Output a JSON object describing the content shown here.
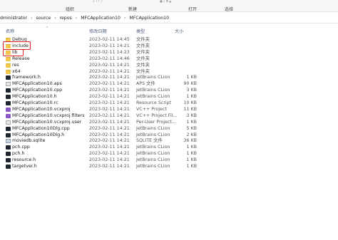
{
  "ribbon": {
    "top_tiny_left": "2 7 T 7",
    "top_tiny_right": "■ 2 ▼ ▲",
    "groups": [
      "组织",
      "新建",
      "打开",
      "选择"
    ]
  },
  "address": {
    "breadcrumbs": [
      "dministrator",
      "source",
      "repos",
      "MFCApplication10",
      "MFCApplication10"
    ]
  },
  "columns": {
    "name": "名称",
    "date": "修改日期",
    "type": "类型",
    "size": "大小"
  },
  "files": [
    {
      "name": "Debug",
      "date": "2023-02-11 14:45",
      "type": "文件夹",
      "size": "",
      "icon": "folder-icon"
    },
    {
      "name": "include",
      "date": "2023-02-11 14:21",
      "type": "文件夹",
      "size": "",
      "icon": "folder-icon"
    },
    {
      "name": "lib",
      "date": "2023-02-11 14:23",
      "type": "文件夹",
      "size": "",
      "icon": "folder-icon"
    },
    {
      "name": "Release",
      "date": "2023-02-11 14:46",
      "type": "文件夹",
      "size": "",
      "icon": "folder-icon"
    },
    {
      "name": "res",
      "date": "2023-02-11 14:21",
      "type": "文件夹",
      "size": "",
      "icon": "folder-icon"
    },
    {
      "name": "x64",
      "date": "2023-02-11 14:21",
      "type": "文件夹",
      "size": "",
      "icon": "folder-icon"
    },
    {
      "name": "framework.h",
      "date": "2023-02-11 14:21",
      "type": "JetBrains CLion",
      "size": "1 KB",
      "icon": "clion-file-icon"
    },
    {
      "name": "MFCApplication10.aps",
      "date": "2023-02-11 14:21",
      "type": "APS 文件",
      "size": "90 KB",
      "icon": "generic-file-icon"
    },
    {
      "name": "MFCApplication10.cpp",
      "date": "2023-02-11 14:21",
      "type": "JetBrains CLion",
      "size": "3 KB",
      "icon": "clion-file-icon"
    },
    {
      "name": "MFCApplication10.h",
      "date": "2023-02-11 14:21",
      "type": "JetBrains CLion",
      "size": "1 KB",
      "icon": "clion-file-icon"
    },
    {
      "name": "MFCApplication10.rc",
      "date": "2023-02-11 14:21",
      "type": "Resource Script",
      "size": "10 KB",
      "icon": "clion-file-icon"
    },
    {
      "name": "MFCApplication10.vcxproj",
      "date": "2023-02-11 14:21",
      "type": "VC++ Project",
      "size": "11 KB",
      "icon": "vs-project-icon"
    },
    {
      "name": "MFCApplication10.vcxproj.filters",
      "date": "2023-02-11 14:21",
      "type": "VC++ Project Fil...",
      "size": "3 KB",
      "icon": "vs-project-icon"
    },
    {
      "name": "MFCApplication10.vcxproj.user",
      "date": "2023-02-11 14:21",
      "type": "Per-User Project...",
      "size": "1 KB",
      "icon": "generic-file-icon"
    },
    {
      "name": "MFCApplication10Dlg.cpp",
      "date": "2023-02-11 14:21",
      "type": "JetBrains CLion",
      "size": "5 KB",
      "icon": "clion-file-icon"
    },
    {
      "name": "MFCApplication10Dlg.h",
      "date": "2023-02-11 14:21",
      "type": "JetBrains CLion",
      "size": "2 KB",
      "icon": "clion-file-icon"
    },
    {
      "name": "moviedb.sqlite",
      "date": "2023-02-11 14:21",
      "type": "SQLITE 文件",
      "size": "36 KB",
      "icon": "database-file-icon"
    },
    {
      "name": "pch.cpp",
      "date": "2023-02-11 14:21",
      "type": "JetBrains CLion",
      "size": "1 KB",
      "icon": "clion-file-icon"
    },
    {
      "name": "pch.h",
      "date": "2023-02-11 14:21",
      "type": "JetBrains CLion",
      "size": "1 KB",
      "icon": "clion-file-icon"
    },
    {
      "name": "resource.h",
      "date": "2023-02-11 14:21",
      "type": "JetBrains CLion",
      "size": "1 KB",
      "icon": "clion-file-icon"
    },
    {
      "name": "targetver.h",
      "date": "2023-02-11 14:21",
      "type": "JetBrains CLion",
      "size": "1 KB",
      "icon": "clion-file-icon"
    }
  ],
  "highlight_color": "#e02020"
}
